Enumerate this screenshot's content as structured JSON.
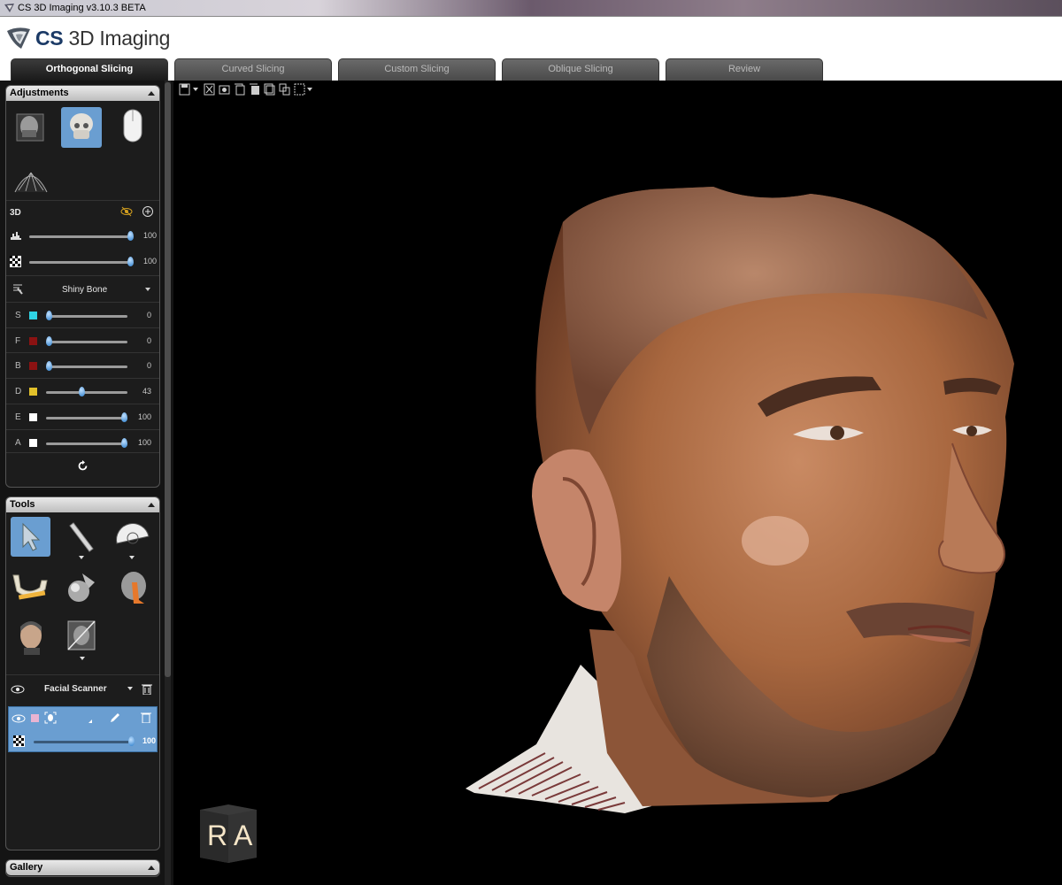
{
  "window": {
    "title": "CS 3D Imaging v3.10.3 BETA"
  },
  "header": {
    "brand_bold": "CS",
    "brand_rest": " 3D Imaging"
  },
  "tabs": [
    {
      "label": "Orthogonal Slicing",
      "active": true
    },
    {
      "label": "Curved Slicing",
      "active": false
    },
    {
      "label": "Custom Slicing",
      "active": false
    },
    {
      "label": "Oblique Slicing",
      "active": false
    },
    {
      "label": "Review",
      "active": false
    }
  ],
  "adjustments": {
    "title": "Adjustments",
    "section_3d": "3D",
    "slider1_value": "100",
    "slider2_value": "100",
    "preset": "Shiny Bone",
    "channels": [
      {
        "label": "S",
        "color": "#2fd3e4",
        "value": "0",
        "pos": 0
      },
      {
        "label": "F",
        "color": "#8b1212",
        "value": "0",
        "pos": 0
      },
      {
        "label": "B",
        "color": "#8b1212",
        "value": "0",
        "pos": 0
      },
      {
        "label": "D",
        "color": "#e2c12a",
        "value": "43",
        "pos": 43
      },
      {
        "label": "E",
        "color": "#ffffff",
        "value": "100",
        "pos": 100
      },
      {
        "label": "A",
        "color": "#ffffff",
        "value": "100",
        "pos": 100
      }
    ]
  },
  "tools": {
    "title": "Tools",
    "layer_name": "Facial Scanner",
    "layer_opacity": "100"
  },
  "gallery": {
    "title": "Gallery"
  },
  "orientation": {
    "left": "R",
    "right": "A"
  },
  "colors": {
    "accent_selected": "#6a9ed1",
    "knob": "#2f7fcb"
  }
}
